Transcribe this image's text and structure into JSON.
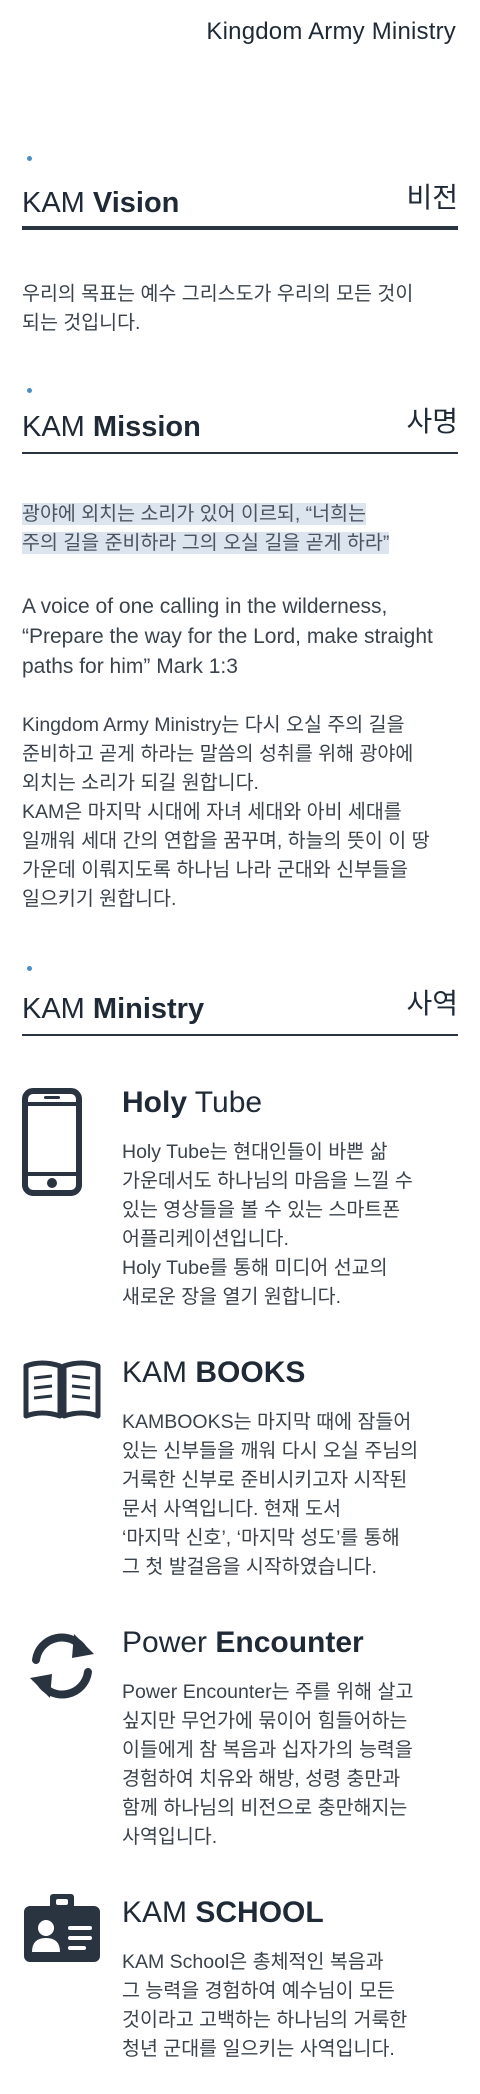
{
  "header": {
    "brand": "Kingdom Army Ministry"
  },
  "vision": {
    "title_light": "KAM",
    "title_bold": "Vision",
    "title_ko": "비전",
    "lines": [
      "우리의 목표는 예수 그리스도가 우리의 모든 것이",
      "되는 것입니다."
    ]
  },
  "mission": {
    "title_light": "KAM",
    "title_bold": "Mission",
    "title_ko": "사명",
    "highlight_lines": [
      "광야에 외치는 소리가 있어 이르되, “너희는",
      "주의 길을 준비하라 그의 오실 길을 곧게 하라”"
    ],
    "english_lines": [
      "A voice of one calling in the wilderness,",
      "“Prepare the way for the Lord, make straight",
      "paths for him” Mark 1:3"
    ],
    "body_lines": [
      "Kingdom Army Ministry는 다시 오실 주의 길을",
      "준비하고 곧게 하라는 말씀의 성취를 위해 광야에",
      "외치는 소리가 되길 원합니다.",
      "KAM은 마지막 시대에 자녀 세대와 아비 세대를",
      "일깨워 세대 간의 연합을 꿈꾸며, 하늘의 뜻이 이 땅",
      "가운데 이뤄지도록 하나님 나라 군대와 신부들을",
      "일으키기 원합니다."
    ]
  },
  "ministry": {
    "title_light": "KAM",
    "title_bold": "Ministry",
    "title_ko": "사역",
    "items": [
      {
        "icon": "smartphone-icon",
        "title_a": "Holy",
        "title_b": " Tube",
        "bold_first": true,
        "lines": [
          "Holy Tube는 현대인들이 바쁜 삶",
          "가운데서도 하나님의 마음을 느낄 수",
          "있는 영상들을 볼 수 있는 스마트폰",
          "어플리케이션입니다.",
          "Holy Tube를 통해 미디어 선교의",
          "새로운 장을 열기 원합니다."
        ]
      },
      {
        "icon": "open-book-icon",
        "title_a": "KAM ",
        "title_b": "BOOKS",
        "bold_first": false,
        "lines": [
          "KAMBOOKS는 마지막 때에 잠들어",
          "있는 신부들을 깨워 다시 오실 주님의",
          "거룩한 신부로 준비시키고자 시작된",
          "문서 사역입니다. 현재 도서",
          "‘마지막 신호’, ‘마지막 성도’를 통해",
          "그 첫 발걸음을 시작하였습니다."
        ]
      },
      {
        "icon": "sync-arrows-icon",
        "title_a": "Power ",
        "title_b": "Encounter",
        "bold_first": false,
        "lines": [
          "Power Encounter는 주를 위해 살고",
          "싶지만 무언가에 묶이어 힘들어하는",
          "이들에게 참 복음과 십자가의 능력을",
          "경험하여 치유와 해방, 성령 충만과",
          "함께 하나님의 비전으로 충만해지는",
          "사역입니다."
        ]
      },
      {
        "icon": "id-badge-icon",
        "title_a": "KAM ",
        "title_b": "SCHOOL",
        "bold_first": false,
        "lines": [
          "KAM School은 총체적인 복음과",
          "그 능력을 경험하여 예수님이 모든",
          "것이라고 고백하는 하나님의 거룩한",
          "청년 군대를 일으키는 사역입니다."
        ]
      }
    ]
  },
  "colors": {
    "accent_dot": "#4a8fc9",
    "text": "#1f2a36",
    "highlight": "#dce4ee"
  }
}
